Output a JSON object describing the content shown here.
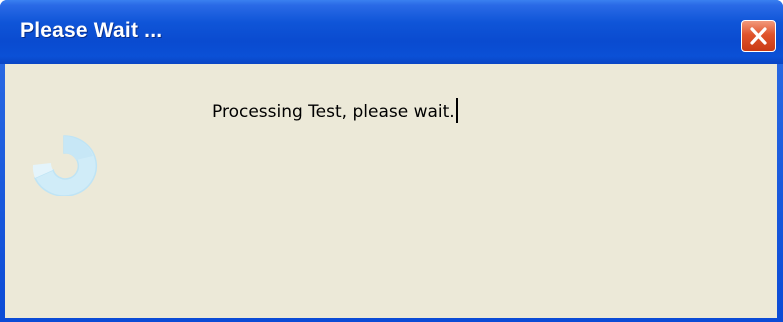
{
  "window": {
    "title": "Please Wait ..."
  },
  "dialog": {
    "message": "Processing Test, please wait."
  },
  "icons": {
    "close": "close-icon",
    "progress": "spinner-icon"
  },
  "colors": {
    "titlebar": "#0a4bd0",
    "close_button": "#e0542c",
    "client_background": "#ece9d8",
    "spinner": "#bfe4f5"
  }
}
